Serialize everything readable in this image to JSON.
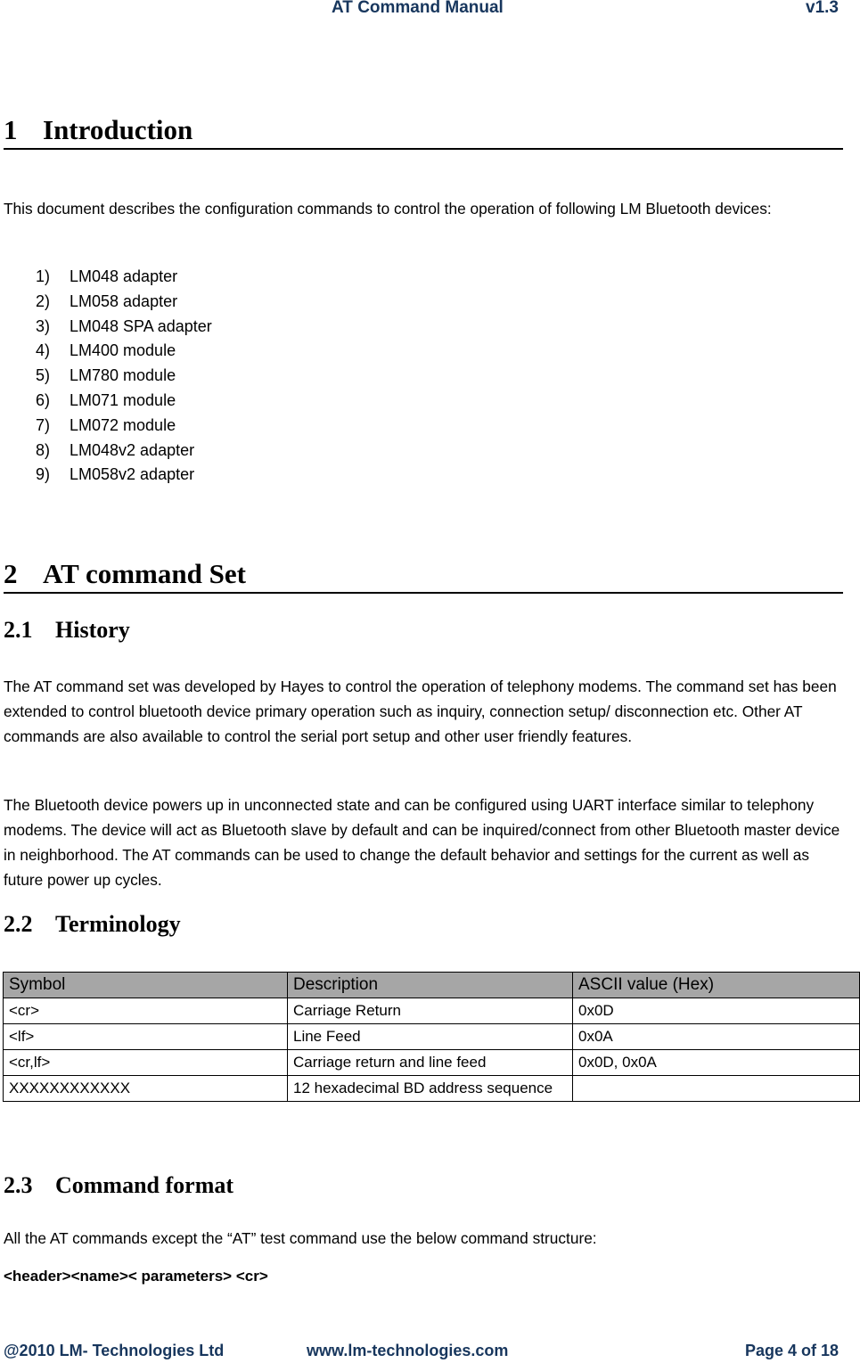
{
  "header": {
    "title": "AT Command Manual",
    "version": "v1.3"
  },
  "sections": {
    "intro": {
      "number": "1",
      "title": "Introduction",
      "paragraph": "This document describes the configuration commands to control the operation of following LM Bluetooth devices:",
      "devices": [
        {
          "marker": "1)",
          "label": "LM048 adapter"
        },
        {
          "marker": "2)",
          "label": "LM058 adapter"
        },
        {
          "marker": "3)",
          "label": "LM048 SPA adapter"
        },
        {
          "marker": "4)",
          "label": "LM400 module"
        },
        {
          "marker": "5)",
          "label": "LM780 module"
        },
        {
          "marker": "6)",
          "label": "LM071 module"
        },
        {
          "marker": "7)",
          "label": "LM072 module"
        },
        {
          "marker": "8)",
          "label": "LM048v2 adapter"
        },
        {
          "marker": "9)",
          "label": "LM058v2 adapter"
        }
      ]
    },
    "at_set": {
      "number": "2",
      "title": "AT command Set"
    },
    "history": {
      "number": "2.1",
      "title": "History",
      "paragraphs": [
        "The AT command set was developed by Hayes to control the operation of telephony modems. The command set has been extended to control bluetooth device primary operation such as inquiry, connection setup/ disconnection etc. Other AT commands are also available to control the serial port setup and other user friendly features.",
        "The Bluetooth device powers up in unconnected state and can be configured using UART interface similar to telephony modems. The device will act as Bluetooth slave by default and can be inquired/connect from other Bluetooth master device in neighborhood.  The AT commands can be used to change the default behavior and settings for the current as well as future power up cycles."
      ]
    },
    "terminology": {
      "number": "2.2",
      "title": "Terminology",
      "columns": [
        "Symbol",
        "Description",
        "ASCII value (Hex)"
      ],
      "rows": [
        [
          "<cr>",
          "Carriage Return",
          "0x0D"
        ],
        [
          "<lf>",
          "Line Feed",
          "0x0A"
        ],
        [
          "<cr,lf>",
          "Carriage return and line feed",
          "0x0D, 0x0A"
        ],
        [
          "XXXXXXXXXXXX",
          "12 hexadecimal BD address sequence",
          ""
        ]
      ]
    },
    "command_format": {
      "number": "2.3",
      "title": "Command format",
      "paragraph": "All the AT commands except the “AT” test command use the below command structure:",
      "structure": "<header><name>< parameters> <cr>"
    }
  },
  "footer": {
    "copyright": "@2010 LM- Technologies Ltd",
    "website": "www.lm-technologies.com",
    "page": "Page 4 of 18"
  }
}
